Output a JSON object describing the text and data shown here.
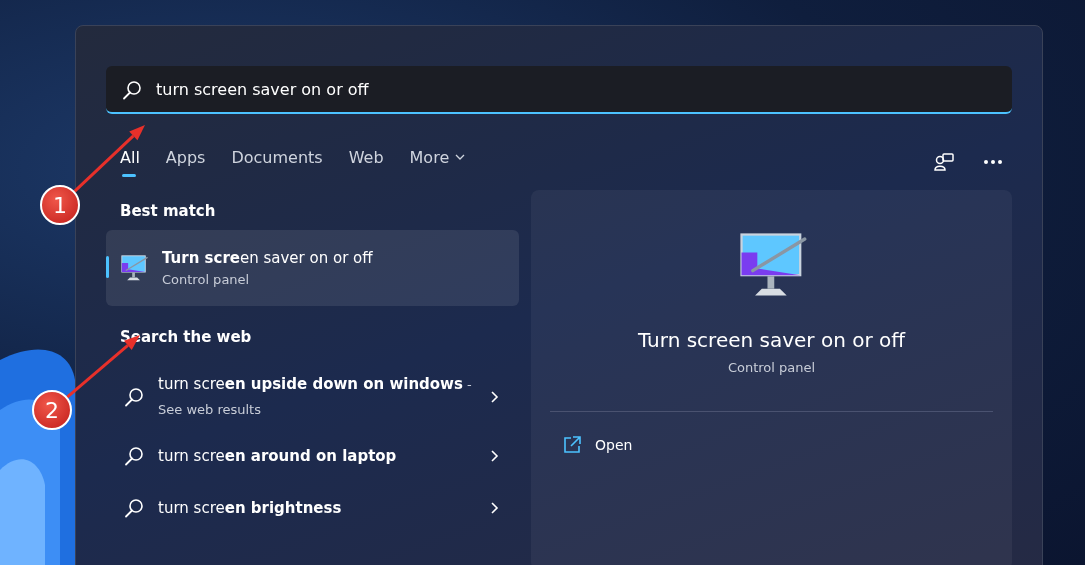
{
  "search": {
    "value": "turn screen saver on or off"
  },
  "tabs": [
    {
      "label": "All",
      "selected": true,
      "kind": "plain"
    },
    {
      "label": "Apps",
      "selected": false,
      "kind": "plain"
    },
    {
      "label": "Documents",
      "selected": false,
      "kind": "plain"
    },
    {
      "label": "Web",
      "selected": false,
      "kind": "plain"
    },
    {
      "label": "More",
      "selected": false,
      "kind": "dropdown"
    }
  ],
  "best_match": {
    "heading": "Best match",
    "title": "**Turn scre**en saver on or off",
    "subtitle": "Control panel",
    "selected": true
  },
  "web": {
    "heading": "Search the web",
    "results": [
      {
        "text": "turn scre**en upside down on windows**",
        "suffix": " - See web results"
      },
      {
        "text": "turn scre**en around on laptop**"
      },
      {
        "text": "turn scre**en brightness**"
      }
    ]
  },
  "preview": {
    "title": "Turn screen saver on or off",
    "subtitle": "Control panel",
    "actions": [
      {
        "label": "Open"
      }
    ]
  },
  "annotations": [
    {
      "label": "1"
    },
    {
      "label": "2"
    }
  ]
}
